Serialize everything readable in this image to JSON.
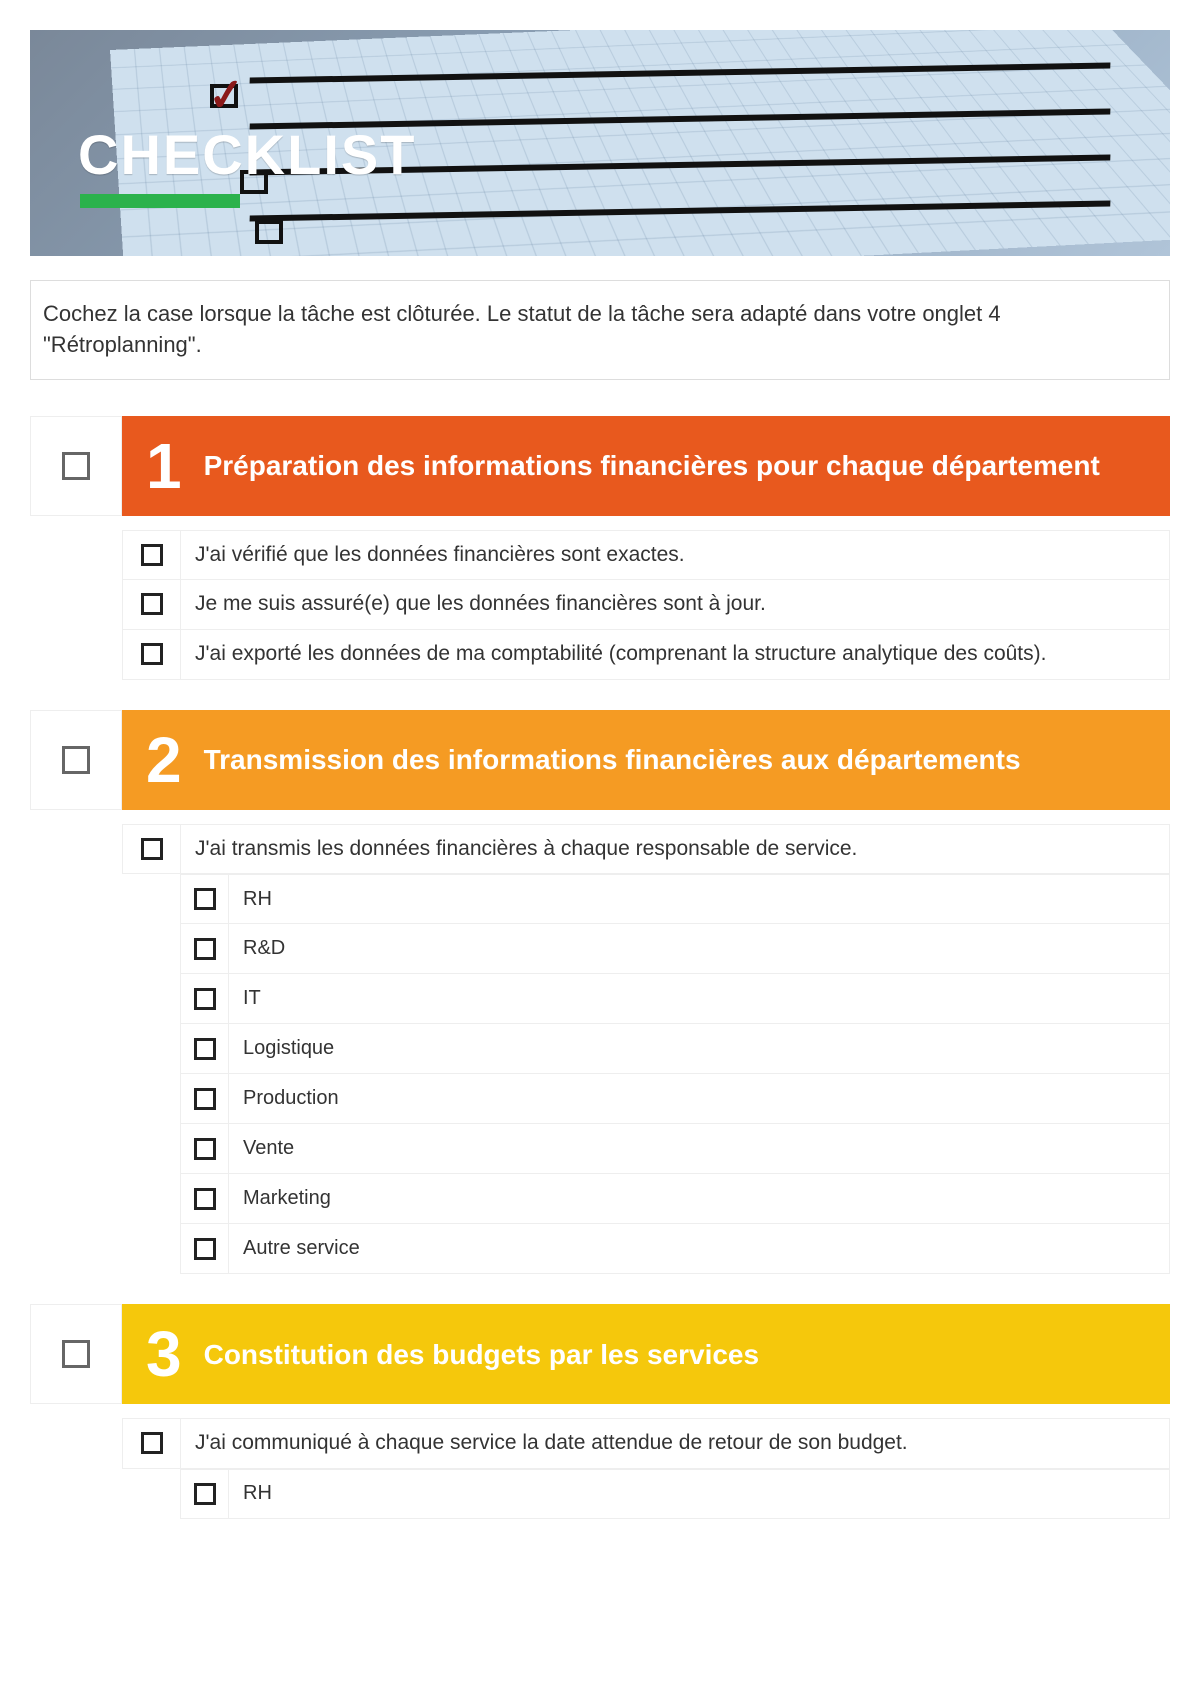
{
  "header": {
    "title": "CHECKLIST"
  },
  "intro": "Cochez la case lorsque la tâche est clôturée. Le statut de la tâche sera adapté dans votre onglet 4 \"Rétroplanning\".",
  "sections": [
    {
      "num": "1",
      "title": "Préparation des informations financières pour chaque département",
      "color": "orange",
      "tasks": [
        "J'ai vérifié que les données financières sont exactes.",
        "Je me suis assuré(e) que les données financières sont à jour.",
        "J'ai exporté les données de ma comptabilité (comprenant la structure analytique des coûts)."
      ],
      "subtasks": []
    },
    {
      "num": "2",
      "title": "Transmission des informations financières aux départements",
      "color": "amber",
      "tasks": [
        "J'ai transmis les données financières à chaque responsable de service."
      ],
      "subtasks": [
        "RH",
        "R&D",
        "IT",
        "Logistique",
        "Production",
        "Vente",
        "Marketing",
        "Autre service"
      ]
    },
    {
      "num": "3",
      "title": "Constitution des budgets par les services",
      "color": "yellow",
      "tasks": [
        "J'ai communiqué à chaque service la date attendue de retour de son budget."
      ],
      "subtasks": [
        "RH"
      ]
    }
  ]
}
